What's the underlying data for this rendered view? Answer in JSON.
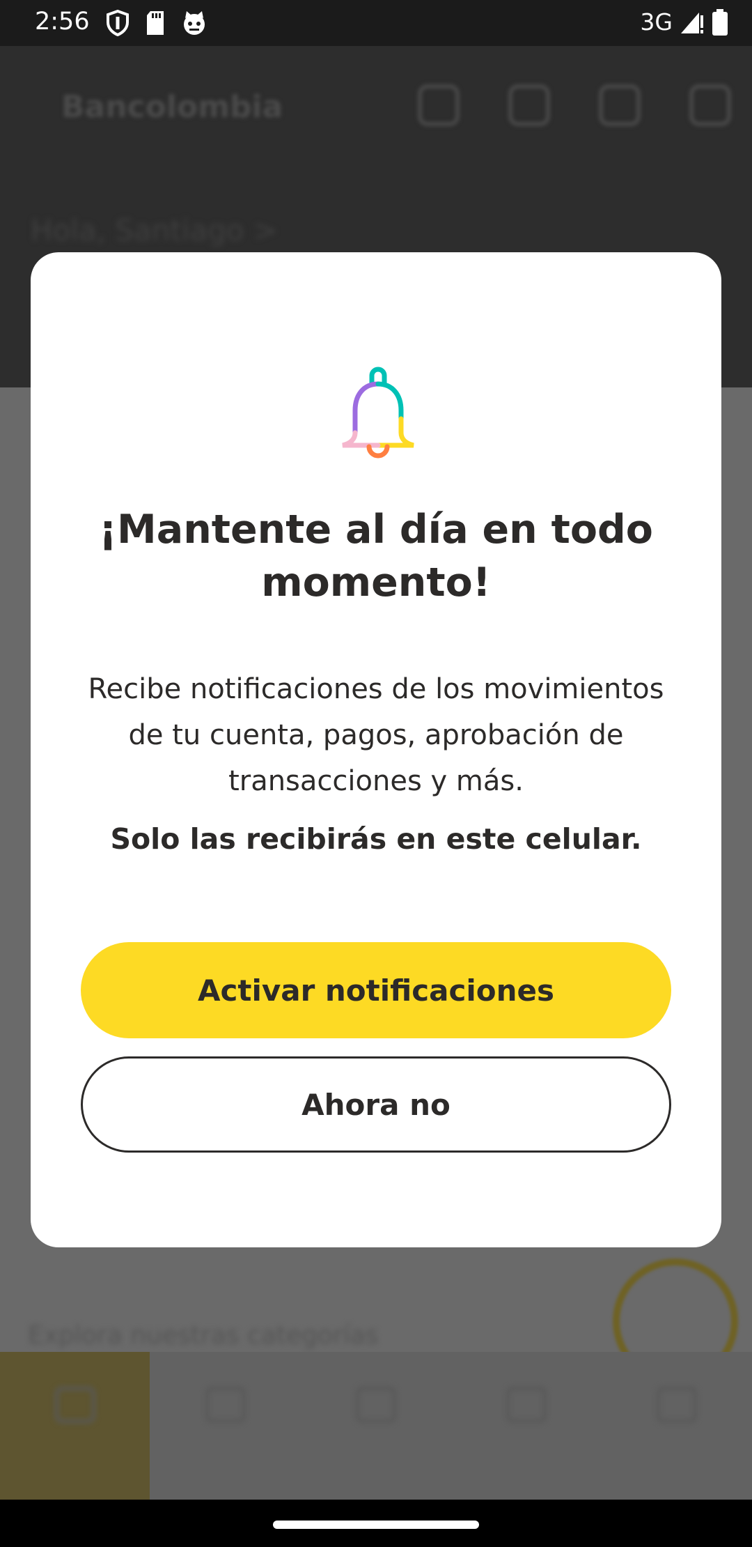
{
  "status_bar": {
    "time": "2:56",
    "network": "3G",
    "left_icons": [
      "shield-icon",
      "sd-card-icon",
      "cat-icon"
    ],
    "right_icons": [
      "signal-icon",
      "battery-icon"
    ]
  },
  "background_app": {
    "logo": "Bancolombia",
    "balance_label": "Hola, Santiago >",
    "footnote": "Explora nuestras categorías"
  },
  "dialog": {
    "icon": "bell-icon",
    "title": "¡Mantente al día en todo momento!",
    "body": "Recibe notificaciones de los movimientos de tu cuenta, pagos, aprobación de transacciones y más.",
    "note": "Solo las recibirás en este celular.",
    "primary_button": "Activar notificaciones",
    "secondary_button": "Ahora no"
  },
  "colors": {
    "accent_yellow": "#FDDA24",
    "text_dark": "#2C2A29",
    "bell_teal": "#00C1B5",
    "bell_purple": "#9C6CE0",
    "bell_pink": "#F5B6CD",
    "bell_yellow": "#FDDA24",
    "bell_orange": "#FF7F41"
  }
}
